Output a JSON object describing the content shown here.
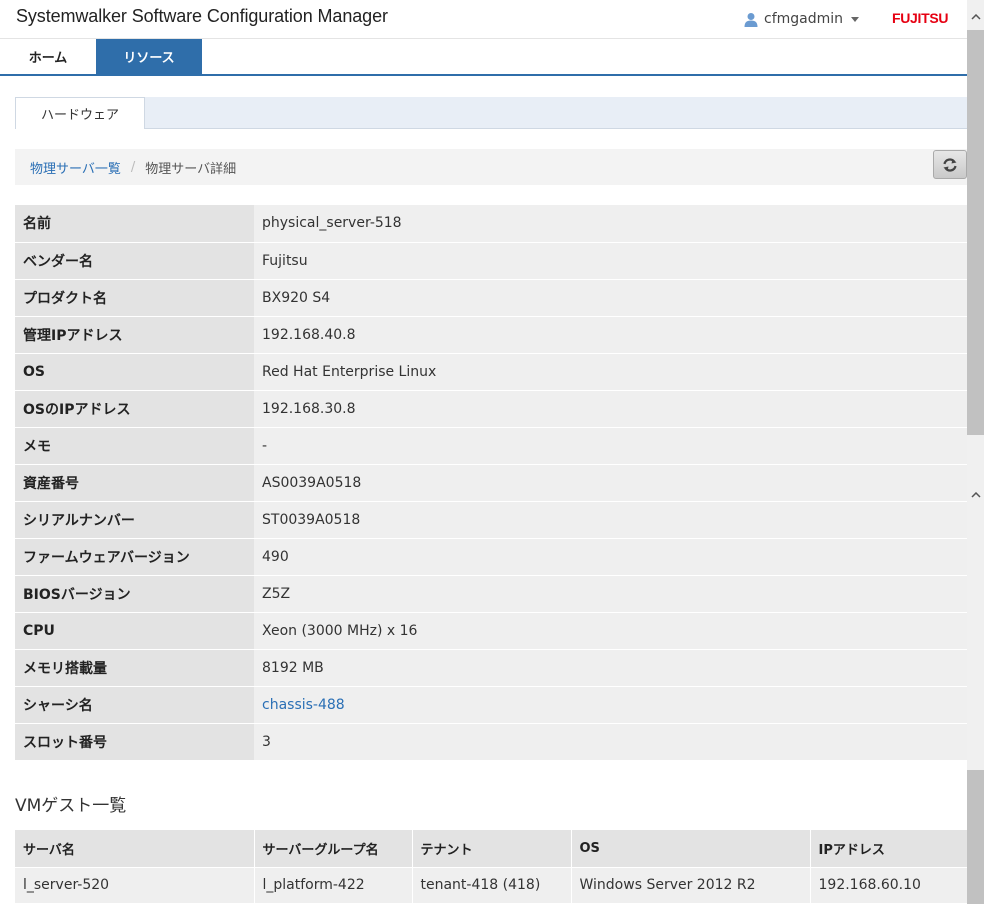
{
  "header": {
    "app_title": "Systemwalker Software Configuration Manager",
    "username": "cfmgadmin",
    "brand": "FUJITSU"
  },
  "nav": {
    "home": "ホーム",
    "resource": "リソース"
  },
  "subtab": {
    "hardware": "ハードウェア"
  },
  "breadcrumb": {
    "parent": "物理サーバ一覧",
    "separator": "/",
    "current": "物理サーバ詳細"
  },
  "details": [
    {
      "label": "名前",
      "value": "physical_server-518"
    },
    {
      "label": "ベンダー名",
      "value": "Fujitsu"
    },
    {
      "label": "プロダクト名",
      "value": "BX920 S4"
    },
    {
      "label": "管理IPアドレス",
      "value": "192.168.40.8"
    },
    {
      "label": "OS",
      "value": "Red Hat Enterprise Linux"
    },
    {
      "label": "OSのIPアドレス",
      "value": "192.168.30.8"
    },
    {
      "label": "メモ",
      "value": "-"
    },
    {
      "label": "資産番号",
      "value": "AS0039A0518"
    },
    {
      "label": "シリアルナンバー",
      "value": "ST0039A0518"
    },
    {
      "label": "ファームウェアバージョン",
      "value": "490"
    },
    {
      "label": "BIOSバージョン",
      "value": "Z5Z"
    },
    {
      "label": "CPU",
      "value": "Xeon (3000 MHz) x 16"
    },
    {
      "label": "メモリ搭載量",
      "value": "8192 MB"
    },
    {
      "label": "シャーシ名",
      "value": "chassis-488"
    },
    {
      "label": "スロット番号",
      "value": "3"
    }
  ],
  "vm_section": {
    "title": "VMゲスト一覧",
    "columns": [
      "サーバ名",
      "サーバーグループ名",
      "テナント",
      "OS",
      "IPアドレス"
    ],
    "rows": [
      [
        "l_server-520",
        "l_platform-422",
        "tenant-418 (418)",
        "Windows Server 2012 R2",
        "192.168.60.10"
      ]
    ]
  },
  "colors": {
    "accent": "#2f6eaa",
    "link": "#2a6fb5",
    "brand": "#e60012"
  },
  "icons": {
    "user": "user-icon",
    "caret": "caret-down-icon",
    "refresh": "refresh-icon",
    "scroll_up": "chevron-up-icon"
  }
}
